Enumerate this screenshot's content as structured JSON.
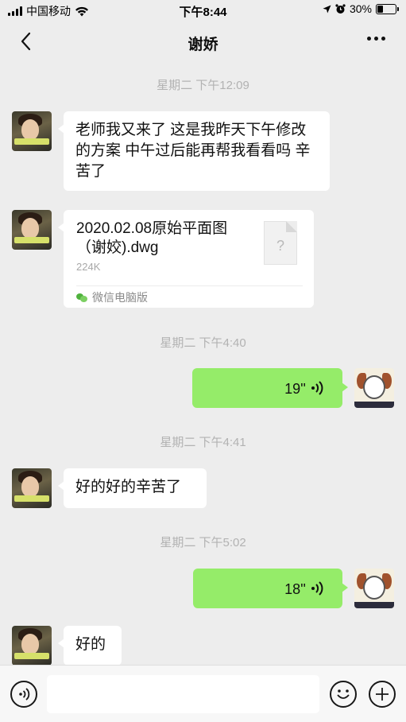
{
  "status_bar": {
    "carrier": "中国移动",
    "time": "下午8:44",
    "battery": "30%",
    "battery_level": 0.3
  },
  "nav": {
    "title": "谢娇"
  },
  "messages": {
    "ts1": "星期二 下午12:09",
    "msg1": "老师我又来了 这是我昨天下午修改的方案 中午过后能再帮我看看吗 辛苦了",
    "file": {
      "name": "2020.02.08原始平面图（谢姣).dwg",
      "size": "224K",
      "icon_glyph": "?",
      "source": "微信电脑版"
    },
    "ts2": "星期二 下午4:40",
    "voice1": "19''",
    "ts3": "星期二 下午4:41",
    "msg2": "好的好的辛苦了",
    "ts4": "星期二 下午5:02",
    "voice2": "18''",
    "msg3": "好的"
  },
  "icons": {
    "back": "chevron-left-icon",
    "more": "more-dots-icon",
    "voice_input": "voice-input-icon",
    "emoji": "emoji-icon",
    "add": "add-icon"
  },
  "colors": {
    "background": "#ededed",
    "outgoing_bubble": "#95ec69",
    "incoming_bubble": "#ffffff",
    "timestamp": "#b2b2b2"
  }
}
